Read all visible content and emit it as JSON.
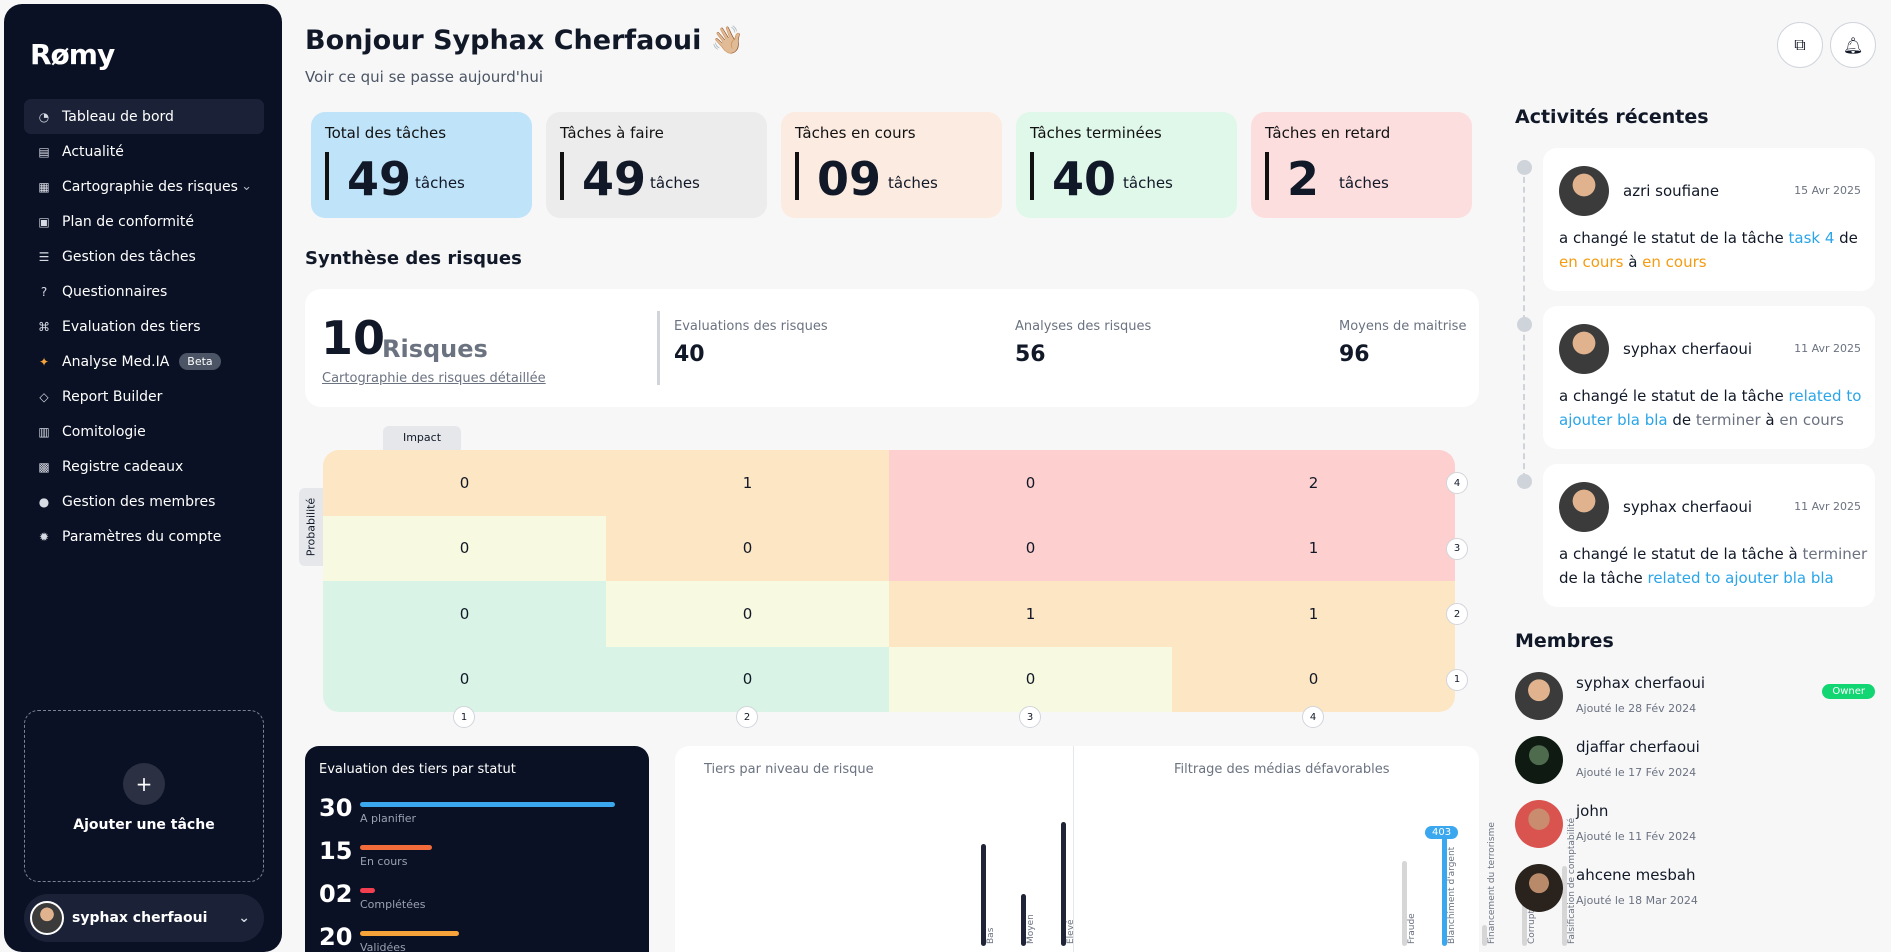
{
  "app": {
    "logo": "Rømy"
  },
  "sidebar": {
    "items": [
      {
        "label": "Tableau de bord",
        "icon": "dashboard-icon"
      },
      {
        "label": "Actualité",
        "icon": "news-icon"
      },
      {
        "label": "Cartographie des risques",
        "icon": "map-icon"
      },
      {
        "label": "Plan de conformité",
        "icon": "clipboard-icon"
      },
      {
        "label": "Gestion des tâches",
        "icon": "tasks-icon"
      },
      {
        "label": "Questionnaires",
        "icon": "question-icon"
      },
      {
        "label": "Evaluation des tiers",
        "icon": "network-icon"
      },
      {
        "label": "Analyse Med.IA",
        "icon": "sparkle-icon",
        "badge": "Beta"
      },
      {
        "label": "Report Builder",
        "icon": "report-icon"
      },
      {
        "label": "Comitologie",
        "icon": "calendar-icon"
      },
      {
        "label": "Registre cadeaux",
        "icon": "gift-icon"
      },
      {
        "label": "Gestion des membres",
        "icon": "users-icon"
      },
      {
        "label": "Paramètres du compte",
        "icon": "gear-icon"
      }
    ],
    "add_task": "Ajouter une tâche",
    "plus": "+",
    "user": "syphax cherfaoui"
  },
  "header": {
    "greeting": "Bonjour Syphax Cherfaoui 👋🏼",
    "subtitle": "Voir ce qui se passe aujourd'hui"
  },
  "cards": [
    {
      "title": "Total des tâches",
      "value": "49",
      "unit": "tâches",
      "color": "#bfe3f9"
    },
    {
      "title": "Tâches à faire",
      "value": "49",
      "unit": "tâches",
      "color": "#ececec"
    },
    {
      "title": "Tâches en cours",
      "value": "09",
      "unit": "tâches",
      "color": "#fcebe1"
    },
    {
      "title": "Tâches terminées",
      "value": "40",
      "unit": "tâches",
      "color": "#dff8ea"
    },
    {
      "title": "Tâches en retard",
      "value": "2",
      "unit": "tâches",
      "color": "#fcdede"
    }
  ],
  "risks": {
    "section_title": "Synthèse des risques",
    "count": "10",
    "label": "Risques",
    "link": "Cartographie des risques détaillée",
    "stats": [
      {
        "label": "Evaluations des risques",
        "value": "40"
      },
      {
        "label": "Analyses des risques",
        "value": "56"
      },
      {
        "label": "Moyens de maitrise",
        "value": "96"
      }
    ]
  },
  "matrix": {
    "impact_label": "Impact",
    "prob_label": "Probabilité",
    "rows": [
      [
        "0",
        "1",
        "0",
        "2"
      ],
      [
        "0",
        "0",
        "0",
        "1"
      ],
      [
        "0",
        "0",
        "1",
        "1"
      ],
      [
        "0",
        "0",
        "0",
        "0"
      ]
    ],
    "colors": [
      [
        "#fde6c4",
        "#fde6c4",
        "#fdd0cf",
        "#fdd0cf"
      ],
      [
        "#f7f9e0",
        "#fde6c4",
        "#fdd0cf",
        "#fdd0cf"
      ],
      [
        "#d9f4e6",
        "#f7f9e0",
        "#fde6c4",
        "#fde6c4"
      ],
      [
        "#d9f4e6",
        "#d9f4e6",
        "#f7f9e0",
        "#fde6c4"
      ]
    ],
    "y_axis": [
      "4",
      "3",
      "2",
      "1"
    ],
    "x_axis": [
      "1",
      "2",
      "3",
      "4"
    ]
  },
  "tiers": {
    "title": "Evaluation des tiers par statut",
    "rows": [
      {
        "value": "30",
        "label": "A planifier",
        "color": "#3ba7ee",
        "fill": 0.85
      },
      {
        "value": "15",
        "label": "En cours",
        "color": "#f26b3a",
        "fill": 0.24
      },
      {
        "value": "02",
        "label": "Complétées",
        "color": "#f23f4f",
        "fill": 0.05
      },
      {
        "value": "20",
        "label": "Validées",
        "color": "#f6a33a",
        "fill": 0.33
      }
    ]
  },
  "chart_data": [
    {
      "type": "bar",
      "title": "Tiers par niveau de risque",
      "categories": [
        "Bas",
        "Moyen",
        "Elevé"
      ],
      "values": [
        0.82,
        0.42,
        1.0
      ]
    },
    {
      "type": "bar",
      "title": "Filtrage des médias défavorables",
      "categories": [
        "Fraude",
        "Blanchiment d'argent",
        "Financement du terrorisme",
        "Corruption",
        "Falsification de comptabilité"
      ],
      "values": [
        0.72,
        1.0,
        0.18,
        0.38,
        0.68
      ],
      "highlight_label": "403"
    }
  ],
  "right": {
    "activities_title": "Activités récentes",
    "members_title": "Membres",
    "activities": [
      {
        "user": "azri soufiane",
        "date": "15 Avr 2025",
        "p1": "a changé le statut de la tâche ",
        "l1": "task 4",
        "p2": " de ",
        "l2": "en cours",
        "p3": " à ",
        "l3": "en cours"
      },
      {
        "user": "syphax cherfaoui",
        "date": "11 Avr 2025",
        "p1": "a changé le statut de la tâche ",
        "l1": "related to ajouter bla bla",
        "p2": " de ",
        "l2": "terminer",
        "p3": " à ",
        "l3": "en cours"
      },
      {
        "user": "syphax cherfaoui",
        "date": "11 Avr 2025",
        "p1": "a changé le statut de la tâche à ",
        "l1": "terminer",
        "p2": " de la tâche ",
        "l2": "related to ajouter bla bla",
        "p3": "",
        "l3": ""
      }
    ],
    "members": [
      {
        "name": "syphax cherfaoui",
        "date": "Ajouté le 28 Fév 2024",
        "badge": "Owner"
      },
      {
        "name": "djaffar cherfaoui",
        "date": "Ajouté le 17 Fév 2024",
        "badge": ""
      },
      {
        "name": "john",
        "date": "Ajouté le 11 Fév 2024",
        "badge": ""
      },
      {
        "name": "ahcene mesbah",
        "date": "Ajouté le 18 Mar 2024",
        "badge": ""
      }
    ]
  }
}
